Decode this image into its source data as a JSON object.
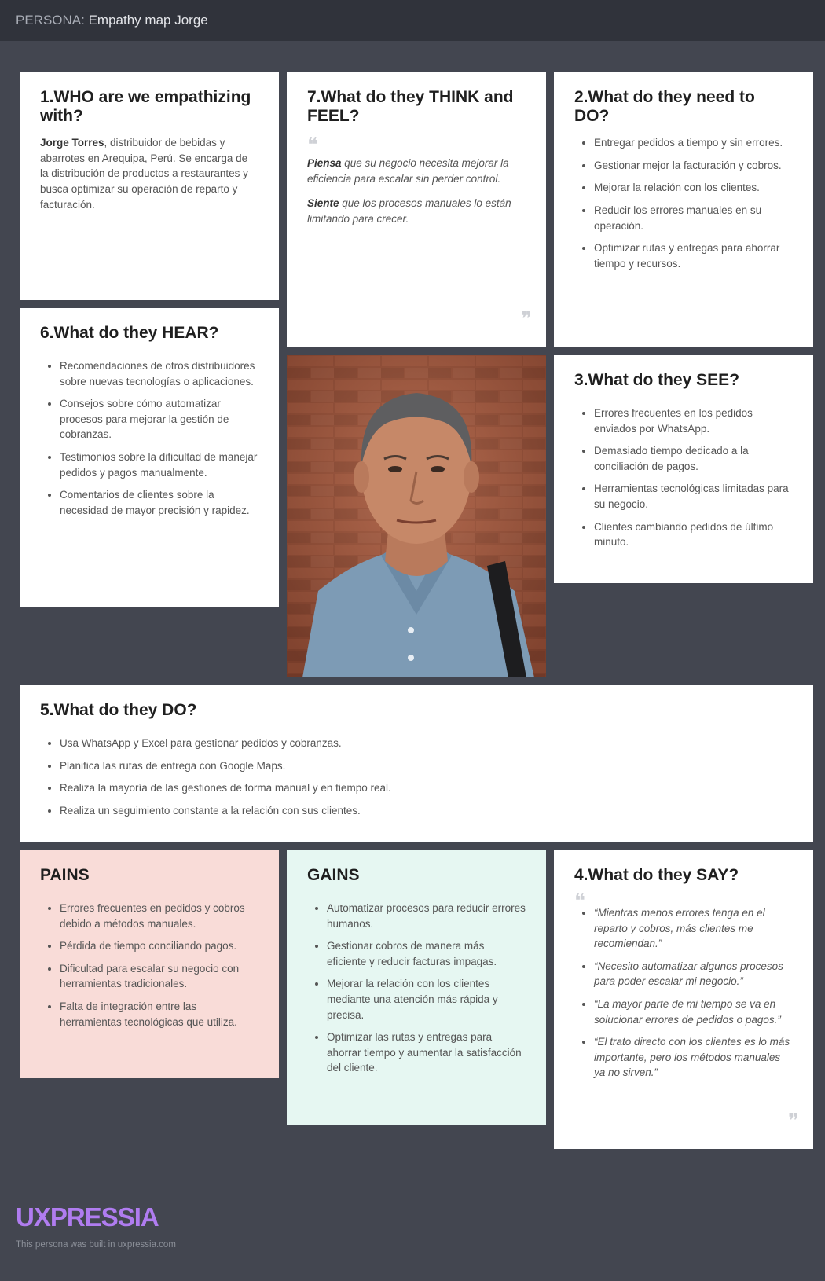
{
  "header": {
    "prefix": "PERSONA: ",
    "title": "Empathy map Jorge"
  },
  "who": {
    "heading": "1.WHO are we empathizing with?",
    "name": "Jorge Torres",
    "description": ", distribuidor de bebidas y abarrotes en Arequipa, Perú. Se encarga de la distribución de productos a restaurantes y busca optimizar su operación de reparto y facturación."
  },
  "think": {
    "heading": "7.What do they THINK and FEEL?",
    "thinks_label": "Piensa",
    "thinks_text": " que su negocio necesita mejorar la eficiencia para escalar sin perder control.",
    "feels_label": "Siente",
    "feels_text": " que los procesos manuales lo están limitando para crecer."
  },
  "need": {
    "heading": "2.What do they need to DO?",
    "items": [
      "Entregar pedidos a tiempo y sin errores.",
      "Gestionar mejor la facturación y cobros.",
      "Mejorar la relación con los clientes.",
      "Reducir los errores manuales en su operación.",
      "Optimizar rutas y entregas para ahorrar tiempo y recursos."
    ]
  },
  "hear": {
    "heading": "6.What do they HEAR?",
    "items": [
      "Recomendaciones de otros distribuidores sobre nuevas tecnologías o aplicaciones.",
      "Consejos sobre cómo automatizar procesos para mejorar la gestión de cobranzas.",
      "Testimonios sobre la dificultad de manejar pedidos y pagos manualmente.",
      "Comentarios de clientes sobre la necesidad de mayor precisión y rapidez."
    ]
  },
  "see": {
    "heading": "3.What do they SEE?",
    "items": [
      "Errores frecuentes en los pedidos enviados por WhatsApp.",
      "Demasiado tiempo dedicado a la conciliación de pagos.",
      "Herramientas tecnológicas limitadas para su negocio.",
      "Clientes cambiando pedidos de último minuto."
    ]
  },
  "do": {
    "heading": "5.What do they DO?",
    "items": [
      "Usa WhatsApp y Excel para gestionar pedidos y cobranzas.",
      "Planifica las rutas de entrega con Google Maps.",
      "Realiza la mayoría de las gestiones de forma manual y en tiempo real.",
      "Realiza un seguimiento constante a la relación con sus clientes."
    ]
  },
  "pains": {
    "heading": "PAINS",
    "items": [
      "Errores frecuentes en pedidos y cobros debido a métodos manuales.",
      "Pérdida de tiempo conciliando pagos.",
      "Dificultad para escalar su negocio con herramientas tradicionales.",
      "Falta de integración entre las herramientas tecnológicas que utiliza."
    ]
  },
  "gains": {
    "heading": "GAINS",
    "items": [
      "Automatizar procesos para reducir errores humanos.",
      "Gestionar cobros de manera más eficiente y reducir facturas impagas.",
      "Mejorar la relación con los clientes mediante una atención más rápida y precisa.",
      "Optimizar las rutas y entregas para ahorrar tiempo y aumentar la satisfacción del cliente."
    ]
  },
  "say": {
    "heading": "4.What do they SAY?",
    "items": [
      "“Mientras menos errores tenga en el reparto y cobros, más clientes me recomiendan.”",
      "“Necesito automatizar algunos procesos para poder escalar mi negocio.”",
      "“La mayor parte de mi tiempo se va en solucionar errores de pedidos o pagos.”",
      "“El trato directo con los clientes es lo más importante, pero los métodos manuales ya no sirven.”"
    ]
  },
  "colors": {
    "background": "#434650",
    "header": "#30333b",
    "pains_bg": "#f9dcd8",
    "gains_bg": "#e6f7f2",
    "brand": "#b07cf0"
  },
  "footer": {
    "logo": "UXPRESSIA",
    "note": "This persona was built in uxpressia.com"
  }
}
